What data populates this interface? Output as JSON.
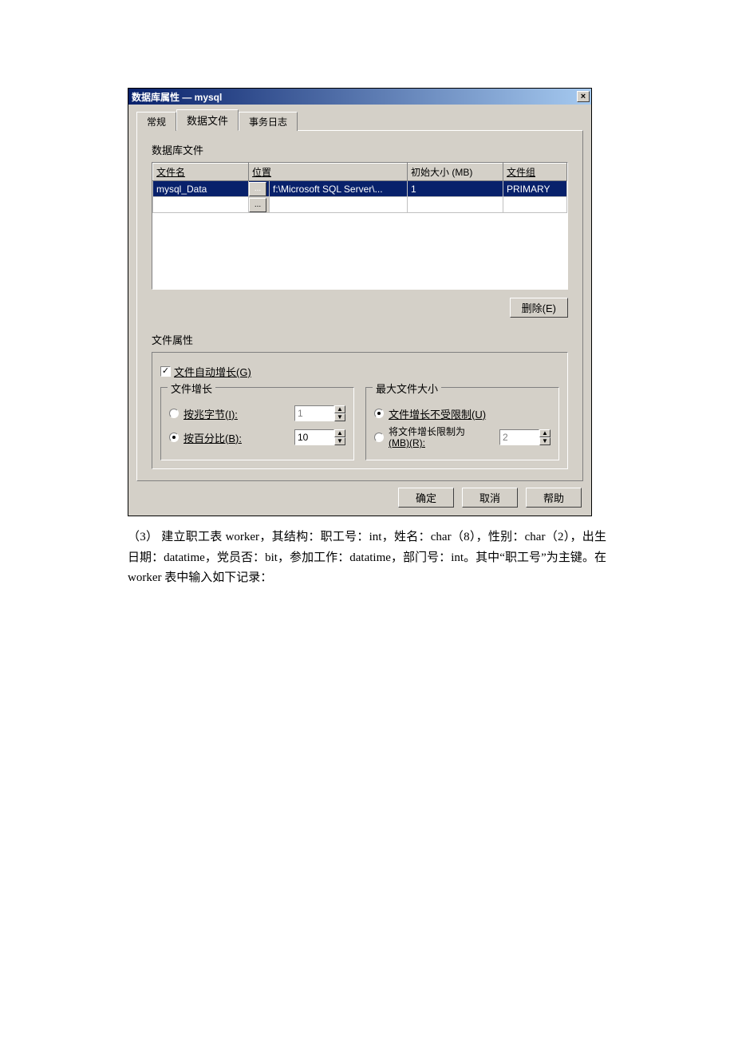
{
  "dialog": {
    "title": "数据库属性 — mysql",
    "close": "×",
    "tabs": {
      "general": "常规",
      "datafiles": "数据文件",
      "txlog": "事务日志"
    },
    "section": "数据库文件",
    "table": {
      "headers": {
        "filename": "文件名",
        "location": "位置",
        "initsize": "初始大小 (MB)",
        "filegroup": "文件组"
      },
      "row": {
        "filename": "mysql_Data",
        "browse": "...",
        "location": "f:\\Microsoft SQL Server\\...",
        "initsize": "1",
        "filegroup": "PRIMARY"
      },
      "browse2": "..."
    },
    "delete": "删除(E)",
    "fileattrs": "文件属性",
    "autogrow": {
      "checked": "✓",
      "label": "文件自动增长(G)"
    },
    "growth": {
      "legend": "文件增长",
      "bymb": "按兆字节(I):",
      "mb_value": "1",
      "bypct": "按百分比(B):",
      "pct_value": "10"
    },
    "maxsize": {
      "legend": "最大文件大小",
      "unlimited": "文件增长不受限制(U)",
      "limited_line1": "将文件增长限制为",
      "limited_line2": "(MB)(R):",
      "limit_value": "2"
    },
    "buttons": {
      "ok": "确定",
      "cancel": "取消",
      "help": "帮助"
    }
  },
  "doc": {
    "p1": "（3） 建立职工表 worker，其结构：职工号：int，姓名：char（8），性别：char（2），出生日期：datatime，党员否：bit，参加工作：datatime，部门号：int。其中“职工号”为主键。在 worker 表中输入如下记录："
  }
}
